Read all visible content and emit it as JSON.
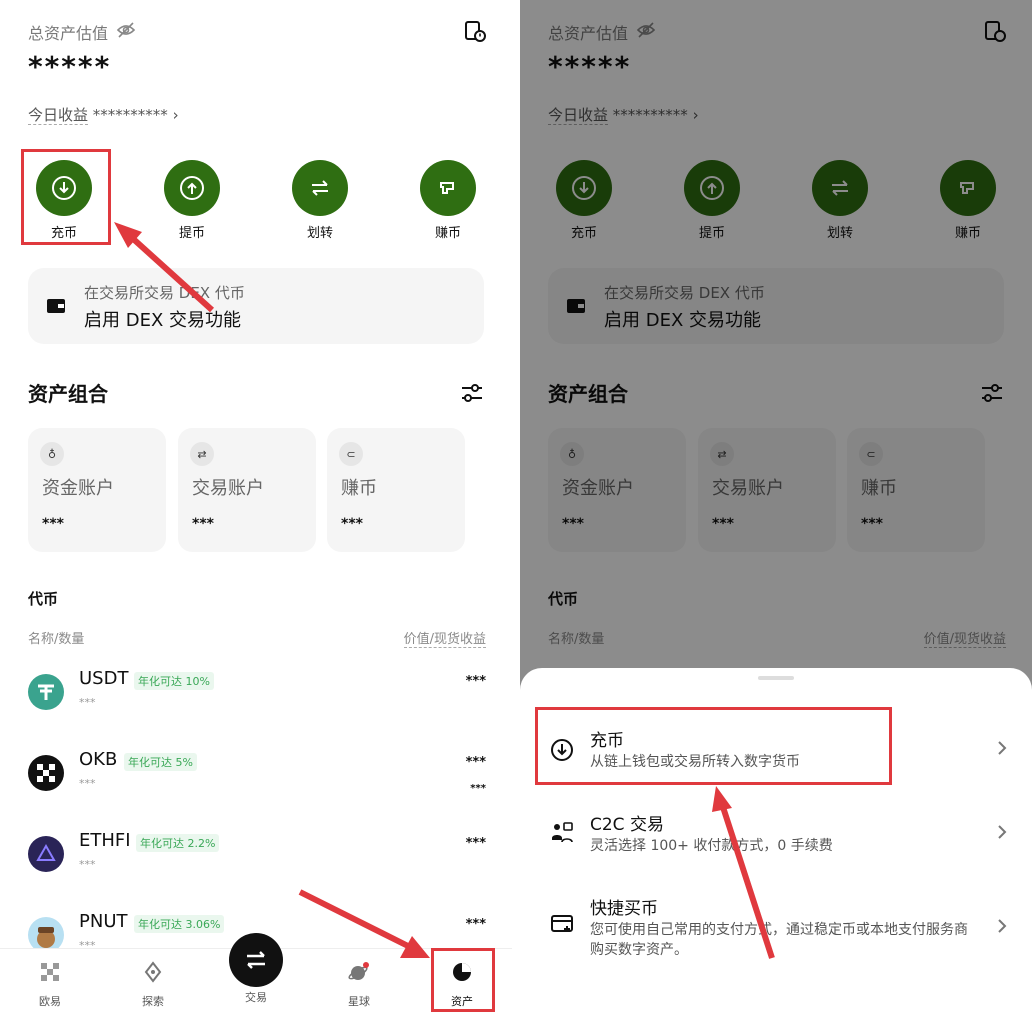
{
  "left": {
    "total_label": "总资产估值",
    "total_value": "*****",
    "today_label": "今日收益",
    "today_value": "**********",
    "today_chevron": "›",
    "actions": [
      {
        "label": "充币",
        "icon": "deposit-icon"
      },
      {
        "label": "提币",
        "icon": "withdraw-icon"
      },
      {
        "label": "划转",
        "icon": "transfer-icon"
      },
      {
        "label": "赚币",
        "icon": "earn-icon"
      }
    ],
    "dex": {
      "line1": "在交易所交易 DEX 代币",
      "line2": "启用 DEX 交易功能"
    },
    "portfolio_title": "资产组合",
    "accounts": [
      {
        "name": "资金账户",
        "value": "***",
        "icon_glyph": "♁"
      },
      {
        "name": "交易账户",
        "value": "***",
        "icon_glyph": "⇄"
      },
      {
        "name": "赚币",
        "value": "***",
        "icon_glyph": "⊂"
      }
    ],
    "tokens_title": "代币",
    "tokens_header_left": "名称/数量",
    "tokens_header_right": "价值/现货收益",
    "tokens": [
      {
        "symbol": "USDT",
        "apy": "年化可达 10%",
        "amount": "***",
        "value": "***",
        "value2": ""
      },
      {
        "symbol": "OKB",
        "apy": "年化可达 5%",
        "amount": "***",
        "value": "***",
        "value2": "***"
      },
      {
        "symbol": "ETHFI",
        "apy": "年化可达 2.2%",
        "amount": "***",
        "value": "***",
        "value2": ""
      },
      {
        "symbol": "PNUT",
        "apy": "年化可达 3.06%",
        "amount": "***",
        "value": "***",
        "value2": ""
      }
    ],
    "tabs": [
      {
        "label": "欧易",
        "icon": "okx-logo-icon"
      },
      {
        "label": "探索",
        "icon": "compass-icon"
      },
      {
        "label": "交易",
        "icon": "swap-icon"
      },
      {
        "label": "星球",
        "icon": "planet-icon"
      },
      {
        "label": "资产",
        "icon": "pie-chart-icon"
      }
    ]
  },
  "right": {
    "total_label": "总资产估值",
    "total_value": "*****",
    "today_label": "今日收益",
    "today_value": "**********",
    "today_chevron": "›",
    "actions": [
      {
        "label": "充币"
      },
      {
        "label": "提币"
      },
      {
        "label": "划转"
      },
      {
        "label": "赚币"
      }
    ],
    "dex": {
      "line1": "在交易所交易 DEX 代币",
      "line2": "启用 DEX 交易功能"
    },
    "portfolio_title": "资产组合",
    "accounts": [
      {
        "name": "资金账户",
        "value": "***",
        "icon_glyph": "♁"
      },
      {
        "name": "交易账户",
        "value": "***",
        "icon_glyph": "⇄"
      },
      {
        "name": "赚币",
        "value": "***",
        "icon_glyph": "⊂"
      }
    ],
    "tokens_title": "代币",
    "tokens_header_left": "名称/数量",
    "tokens_header_right": "价值/现货收益",
    "sheet": {
      "options": [
        {
          "title": "充币",
          "desc": "从链上钱包或交易所转入数字货币",
          "icon": "deposit-icon"
        },
        {
          "title": "C2C 交易",
          "desc": "灵活选择 100+ 收付款方式，0 手续费",
          "icon": "people-icon"
        },
        {
          "title": "快捷买币",
          "desc": "您可使用自己常用的支付方式，通过稳定币或本地支付服务商购买数字资产。",
          "icon": "card-icon"
        }
      ]
    }
  },
  "colors": {
    "accent_green": "#2f6e12",
    "highlight_red": "#e0393e",
    "apy_green": "#3aa857"
  }
}
